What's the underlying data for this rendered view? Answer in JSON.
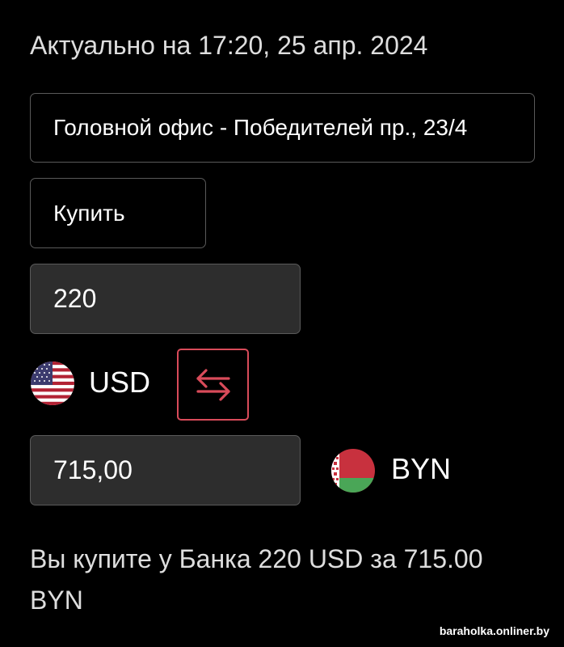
{
  "header": {
    "updated_text": "Актуально на 17:20, 25 апр. 2024"
  },
  "branch_select": {
    "value": "Головной офис - Победителей пр., 23/4"
  },
  "operation_select": {
    "value": "Купить"
  },
  "from": {
    "amount": "220",
    "currency": "USD",
    "flag_icon": "us-flag-icon"
  },
  "to": {
    "amount": "715,00",
    "currency": "BYN",
    "flag_icon": "belarus-flag-icon"
  },
  "swap": {
    "icon": "swap-arrows-icon",
    "color": "#d94b5a"
  },
  "summary": {
    "text": "Вы купите у Банка 220 USD за 715.00 BYN"
  },
  "watermark": {
    "text": "baraholka.onliner.by"
  }
}
